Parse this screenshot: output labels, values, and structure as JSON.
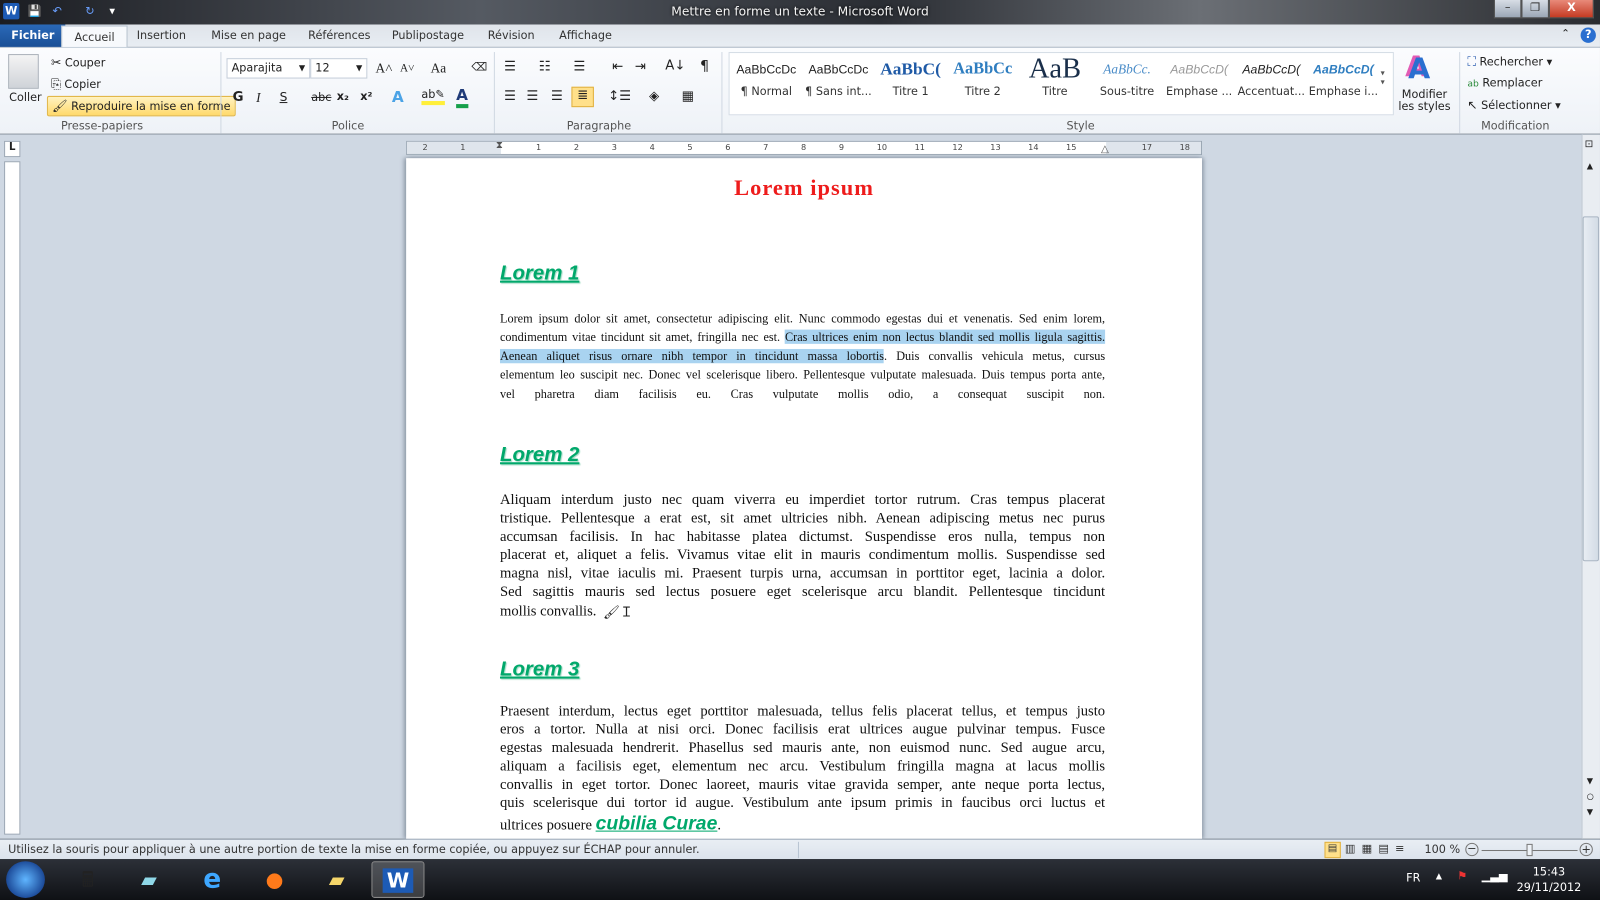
{
  "window": {
    "title": "Mettre en forme un texte - Microsoft Word",
    "minimize": "–",
    "restore": "❐",
    "close": "X"
  },
  "qat": {
    "app_icon": "W",
    "save": "💾",
    "undo": "↶",
    "redo": "↻",
    "customize": "▾"
  },
  "tabs": [
    {
      "label": "Fichier"
    },
    {
      "label": "Accueil",
      "active": true
    },
    {
      "label": "Insertion"
    },
    {
      "label": "Mise en page"
    },
    {
      "label": "Références"
    },
    {
      "label": "Publipostage"
    },
    {
      "label": "Révision"
    },
    {
      "label": "Affichage"
    }
  ],
  "ribbon": {
    "clipboard": {
      "label": "Presse-papiers",
      "paste": "Coller",
      "cut": "Couper",
      "copy": "Copier",
      "format_painter": "Reproduire la mise en forme"
    },
    "font": {
      "label": "Police",
      "font_name": "Aparajita",
      "font_size": "12",
      "bold": "G",
      "italic": "I",
      "underline": "S",
      "strike": "abc",
      "subscript": "x₂",
      "superscript": "x²",
      "grow": "A˄",
      "shrink": "A˅",
      "case": "Aa"
    },
    "paragraph": {
      "label": "Paragraphe",
      "show_marks": "¶"
    },
    "styles": {
      "label": "Style",
      "items": [
        {
          "sample": "AaBbCcDc",
          "name": "¶ Normal"
        },
        {
          "sample": "AaBbCcDc",
          "name": "¶ Sans int..."
        },
        {
          "sample": "AaBbC(",
          "name": "Titre 1"
        },
        {
          "sample": "AaBbCc",
          "name": "Titre 2"
        },
        {
          "sample": "AaB",
          "name": "Titre"
        },
        {
          "sample": "AaBbCc.",
          "name": "Sous-titre"
        },
        {
          "sample": "AaBbCcD(",
          "name": "Emphase ..."
        },
        {
          "sample": "AaBbCcD(",
          "name": "Accentuat..."
        },
        {
          "sample": "AaBbCcD(",
          "name": "Emphase i..."
        }
      ],
      "change_styles": "Modifier les styles"
    },
    "editing": {
      "label": "Modification",
      "find": "Rechercher",
      "replace": "Remplacer",
      "select": "Sélectionner"
    }
  },
  "ruler": {
    "ticks": [
      "2",
      "1",
      "",
      "1",
      "2",
      "3",
      "4",
      "5",
      "6",
      "7",
      "8",
      "9",
      "10",
      "11",
      "12",
      "13",
      "14",
      "15",
      "",
      "17",
      "18"
    ]
  },
  "document": {
    "title": "Lorem ipsum",
    "sections": [
      {
        "heading": "Lorem 1",
        "lines": [
          [
            {
              "t": "Lorem ipsum dolor sit amet, consectetur adipiscing elit. Nunc commodo egestas dui et venenatis. Sed enim lorem,"
            }
          ],
          [
            {
              "t": "condimentum vitae tincidunt sit amet, fringilla nec est. "
            },
            {
              "t": "Cras ultrices enim non lectus blandit sed mollis ligula sagittis.",
              "hl": true
            }
          ],
          [
            {
              "t": "Aenean aliquet risus ornare nibh tempor in tincidunt massa lobortis",
              "hl": true
            },
            {
              "t": ". Duis convallis vehicula metus, cursus"
            }
          ],
          [
            {
              "t": "elementum leo suscipit nec. Donec vel scelerisque libero. Pellentesque vulputate malesuada. Duis tempus porta ante,"
            }
          ],
          [
            {
              "t": "vel pharetra diam facilisis eu. Cras vulputate mollis odio, a consequat suscipit non."
            }
          ]
        ]
      },
      {
        "heading": "Lorem 2",
        "lines": [
          "Aliquam interdum justo nec quam viverra eu imperdiet tortor rutrum. Cras tempus placerat",
          "tristique. Pellentesque a erat est, sit amet ultricies nibh. Aenean adipiscing metus nec purus",
          "accumsan facilisis. In hac habitasse platea dictumst. Suspendisse eros nulla, tempus non",
          "placerat et, aliquet a felis. Vivamus vitae elit in mauris condimentum mollis. Suspendisse sed",
          "magna nisl, vitae iaculis mi. Praesent turpis urna, accumsan in porttitor eget, lacinia a dolor.",
          "Sed sagittis mauris sed lectus posuere eget scelerisque arcu blandit. Pellentesque tincidunt",
          "mollis convallis."
        ]
      },
      {
        "heading": "Lorem 3",
        "lines": [
          "Praesent interdum, lectus eget porttitor malesuada, tellus felis placerat tellus, et tempus justo",
          "eros a tortor. Nulla at nisi orci. Donec facilisis erat ultrices augue pulvinar tempus. Fusce",
          "egestas malesuada hendrerit. Phasellus sed mauris ante, non euismod nunc. Sed augue arcu,",
          "aliquam a facilisis eget, elementum nec arcu. Vestibulum fringilla magna at lacus mollis",
          "convallis in eget tortor. Donec laoreet, mauris vitae gravida semper, ante neque porta lectus,",
          "quis scelerisque dui tortor id augue. Vestibulum ante ipsum primis in faucibus orci luctus et"
        ],
        "last_line": {
          "before": "ultrices posuere ",
          "styled": "cubilia Curae",
          "after": "."
        }
      }
    ]
  },
  "statusbar": {
    "message": "Utilisez la souris pour appliquer à une autre portion de texte la mise en forme copiée, ou appuyez sur ÉCHAP pour annuler.",
    "zoom": "100 %",
    "zoom_level": 100
  },
  "taskbar": {
    "language": "FR",
    "time": "15:43",
    "date": "29/11/2012"
  },
  "colors": {
    "title_red": "#ee1c1c",
    "heading_green": "#00a86b",
    "selection": "#a9d3f0",
    "file_tab": "#2a69b8"
  }
}
